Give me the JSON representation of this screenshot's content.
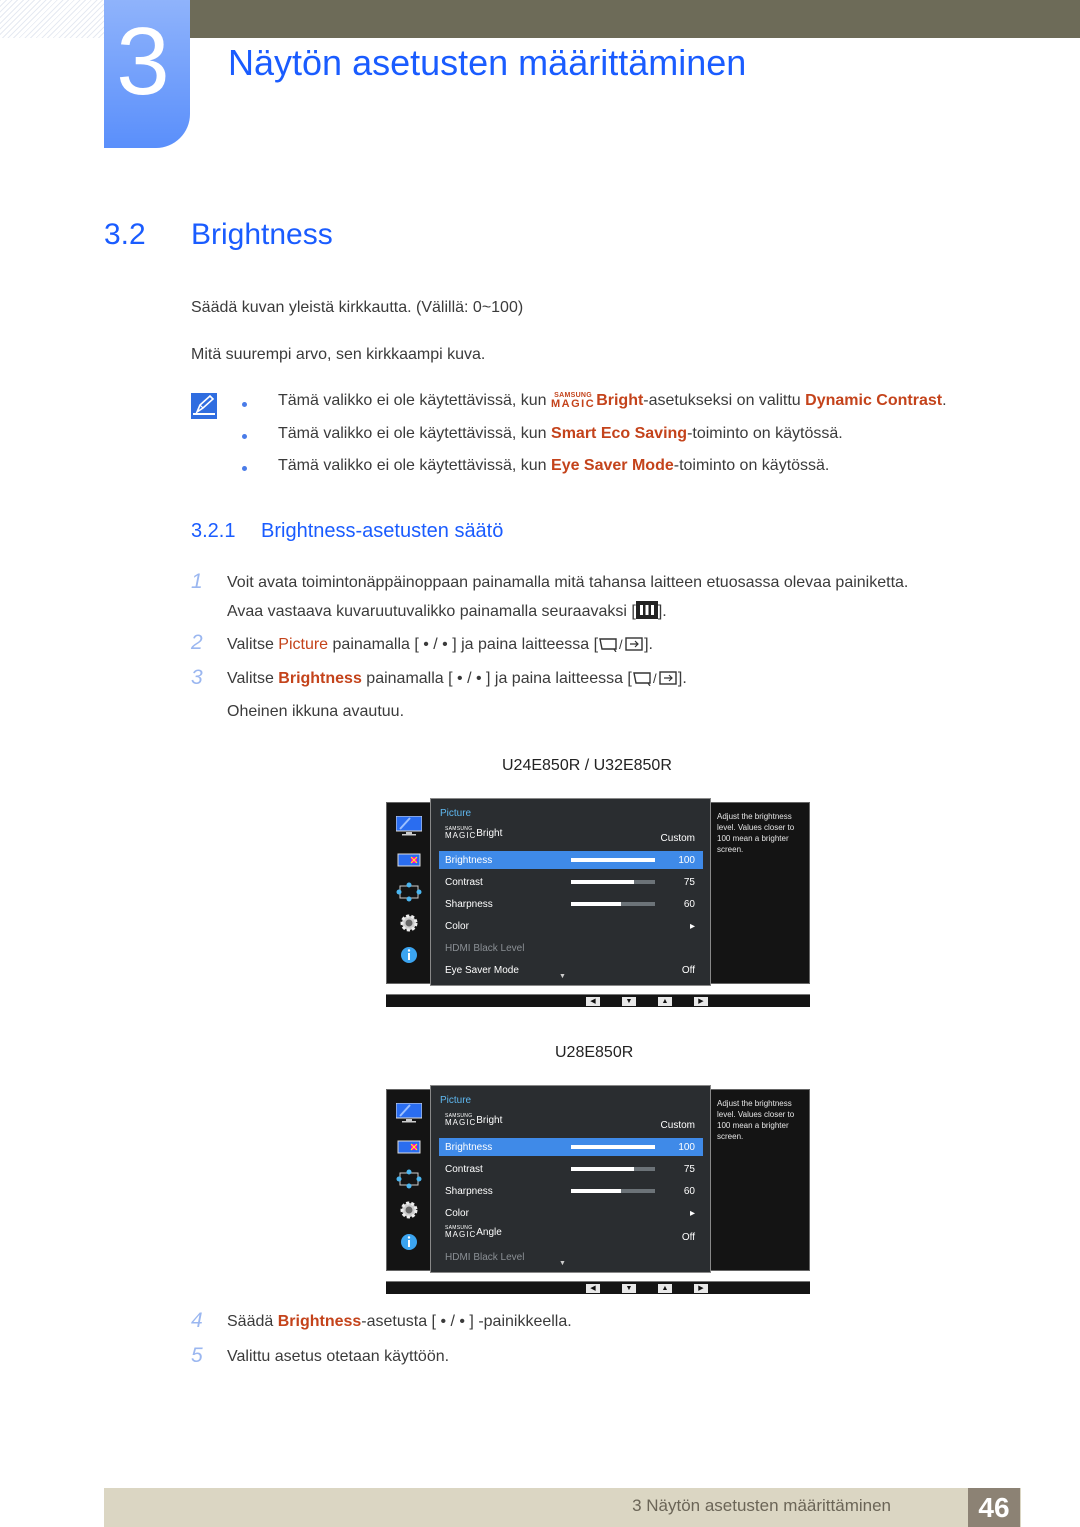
{
  "header": {
    "chapter_number": "3",
    "chapter_title": "Näytön asetusten määrittäminen"
  },
  "section": {
    "number": "3.2",
    "title": "Brightness",
    "intro": [
      "Säädä kuvan yleistä kirkkautta. (Välillä: 0~100)",
      "Mitä suurempi arvo, sen kirkkaampi kuva."
    ]
  },
  "notes": [
    {
      "pre": "Tämä valikko ei ole käytettävissä, kun ",
      "magic_top": "SAMSUNG",
      "magic_bottom": "MAGIC",
      "hl1": "Bright",
      "mid": "-asetukseksi on valittu ",
      "hl2": "Dynamic Contrast",
      "post": "."
    },
    {
      "pre": "Tämä valikko ei ole käytettävissä, kun ",
      "hl": "Smart Eco Saving",
      "post": "-toiminto on käytössä."
    },
    {
      "pre": "Tämä valikko ei ole käytettävissä, kun ",
      "hl": "Eye Saver Mode",
      "post": "-toiminto on käytössä."
    }
  ],
  "subsection": {
    "number": "3.2.1",
    "title": "Brightness-asetusten säätö"
  },
  "steps": [
    {
      "num": "1",
      "line1": "Voit avata toimintonäppäinoppaan painamalla mitä tahansa laitteen etuosassa olevaa painiketta.",
      "line2_pre": "Avaa vastaava kuvaruutuvalikko painamalla seuraavaksi [",
      "line2_post": "]."
    },
    {
      "num": "2",
      "pre": "Valitse ",
      "hl": "Picture",
      "mid": " painamalla [ • / • ] ja paina laitteessa [",
      "post": "]."
    },
    {
      "num": "3",
      "pre": "Valitse ",
      "hl": "Brightness",
      "mid": " painamalla [ • / • ] ja paina laitteessa [",
      "post": "].",
      "line2": "Oheinen ikkuna avautuu."
    },
    {
      "num": "4",
      "pre": "Säädä ",
      "hl": "Brightness",
      "post": "-asetusta [ • / • ] -painikkeella."
    },
    {
      "num": "5",
      "text": "Valittu asetus otetaan käyttöön."
    }
  ],
  "osd_screens": [
    {
      "model": "U24E850R / U32E850R",
      "menu_title": "Picture",
      "help_text": "Adjust the brightness level. Values closer to 100 mean a brighter screen.",
      "rows": [
        {
          "magic": true,
          "label": "Bright",
          "value": "Custom"
        },
        {
          "label": "Brightness",
          "value": "100",
          "level": 100,
          "selected": true
        },
        {
          "label": "Contrast",
          "value": "75",
          "level": 75
        },
        {
          "label": "Sharpness",
          "value": "60",
          "level": 60
        },
        {
          "label": "Color",
          "value": "▸"
        },
        {
          "label": "HDMI Black Level",
          "value": "",
          "disabled": true
        },
        {
          "label": "Eye Saver Mode",
          "value": "Off"
        }
      ]
    },
    {
      "model": "U28E850R",
      "menu_title": "Picture",
      "help_text": "Adjust the brightness level. Values closer to 100 mean a brighter screen.",
      "rows": [
        {
          "magic": true,
          "label": "Bright",
          "value": "Custom"
        },
        {
          "label": "Brightness",
          "value": "100",
          "level": 100,
          "selected": true
        },
        {
          "label": "Contrast",
          "value": "75",
          "level": 75
        },
        {
          "label": "Sharpness",
          "value": "60",
          "level": 60
        },
        {
          "label": "Color",
          "value": "▸"
        },
        {
          "magic": true,
          "label": "Angle",
          "value": "Off"
        },
        {
          "label": "HDMI Black Level",
          "value": "",
          "disabled": true
        }
      ]
    }
  ],
  "osd_common": {
    "magic_top": "SAMSUNG",
    "magic_bottom": "MAGIC",
    "scroll_indicator": "▼",
    "nav_buttons": [
      "◀",
      "▼",
      "▲",
      "▶"
    ]
  },
  "footer": {
    "text": "3 Näytön asetusten määrittäminen",
    "page": "46"
  }
}
